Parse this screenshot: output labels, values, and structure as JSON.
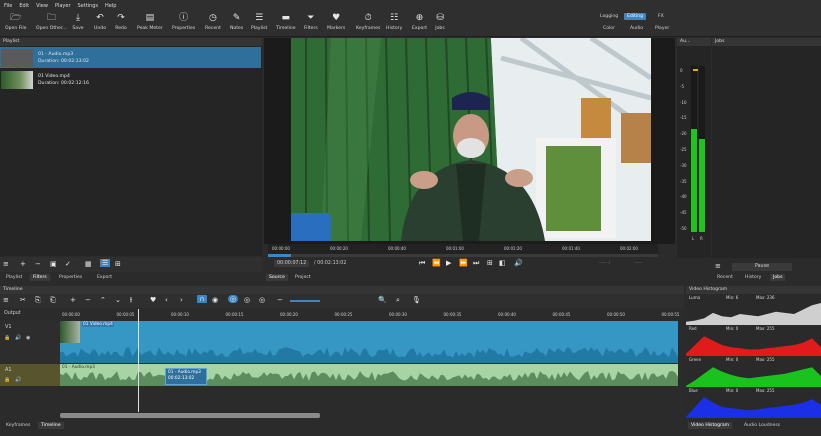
{
  "menu": [
    "File",
    "Edit",
    "View",
    "Player",
    "Settings",
    "Help"
  ],
  "toolbar": [
    {
      "label": "Open File",
      "icon": "folder-icon",
      "glyph": "🗁"
    },
    {
      "label": "Open Other...",
      "icon": "open-other-icon",
      "glyph": "🗀"
    },
    {
      "label": "Save",
      "icon": "save-icon",
      "glyph": "⤓"
    },
    {
      "label": "Undo",
      "icon": "undo-icon",
      "glyph": "↶"
    },
    {
      "label": "Redo",
      "icon": "redo-icon",
      "glyph": "↷"
    },
    {
      "label": "Peak Meter",
      "icon": "peak-meter-icon",
      "glyph": "▤"
    },
    {
      "label": "Properties",
      "icon": "properties-icon",
      "glyph": "ⓘ"
    },
    {
      "label": "Recent",
      "icon": "recent-icon",
      "glyph": "◷"
    },
    {
      "label": "Notes",
      "icon": "notes-icon",
      "glyph": "✎"
    },
    {
      "label": "Playlist",
      "icon": "playlist-icon",
      "glyph": "☰"
    },
    {
      "label": "Timeline",
      "icon": "timeline-icon",
      "glyph": "▬"
    },
    {
      "label": "Filters",
      "icon": "filters-icon",
      "glyph": "⏷"
    },
    {
      "label": "Markers",
      "icon": "markers-icon",
      "glyph": "♥"
    },
    {
      "label": "Keyframes",
      "icon": "keyframes-icon",
      "glyph": "⏱"
    },
    {
      "label": "History",
      "icon": "history-icon",
      "glyph": "☷"
    },
    {
      "label": "Export",
      "icon": "export-icon",
      "glyph": "⊕"
    },
    {
      "label": "Jobs",
      "icon": "jobs-icon",
      "glyph": "⛁"
    }
  ],
  "workspaces": {
    "row1": [
      "Logging",
      "Editing",
      "FX"
    ],
    "row2": [
      "Color",
      "Audio",
      "Player"
    ],
    "selected": "Editing"
  },
  "playlist": {
    "title": "Playlist",
    "items": [
      {
        "name": "01 - Audio.mp3",
        "duration": "Duration: 00:02:13:02",
        "selected": true
      },
      {
        "name": "01 Video.mp4",
        "duration": "Duration: 00:02:12:16",
        "selected": false
      }
    ],
    "tabs": [
      "Playlist",
      "Filters",
      "Properties",
      "Export"
    ]
  },
  "player": {
    "ruler": [
      "00:00:00",
      "00:00:20",
      "00:00:40",
      "00:01:00",
      "00:01:20",
      "00:01:40",
      "00:02:00"
    ],
    "position": "00:00:07:12",
    "duration": "/ 00:02:13:02",
    "tabs": [
      "Source",
      "Project"
    ],
    "progress": 0.06
  },
  "audio": {
    "title": "Au...",
    "labels": [
      "L",
      "R"
    ],
    "scale": [
      "0",
      "-5",
      "-10",
      "-15",
      "-20",
      "-25",
      "-30",
      "-35",
      "-40",
      "-45",
      "-50"
    ],
    "levels": [
      0.62,
      0.56
    ]
  },
  "jobs": {
    "title": "Jobs",
    "pause": "Pause",
    "tabs": [
      "Recent",
      "History",
      "Jobs"
    ]
  },
  "timeline": {
    "title": "Timeline",
    "output_label": "Output",
    "ruler": [
      "00:00:00",
      "00:00:05",
      "00:00:10",
      "00:00:15",
      "00:00:20",
      "00:00:25",
      "00:00:30",
      "00:00:35",
      "00:00:40",
      "00:00:45",
      "00:00:50",
      "00:00:55"
    ],
    "tracks": [
      {
        "name": "V1",
        "clip": "01 Video.mp4"
      },
      {
        "name": "A1",
        "clip": "01 - Audio.mp3",
        "tooltip_name": "01 - Audio.mp3",
        "tooltip_time": "00:02:13:02"
      }
    ],
    "playhead": 0.127,
    "bottom_tabs": [
      "Keyframes",
      "Timeline"
    ]
  },
  "histogram": {
    "title": "Video Histogram",
    "channels": [
      {
        "name": "Luma",
        "min": "Min: 6",
        "max": "Max: 236",
        "color": "#cfcfcf"
      },
      {
        "name": "Red",
        "min": "Min: 0",
        "max": "Max: 255",
        "color": "#e01b1b"
      },
      {
        "name": "Green",
        "min": "Min: 0",
        "max": "Max: 255",
        "color": "#19c21c"
      },
      {
        "name": "Blue",
        "min": "Min: 0",
        "max": "Max: 255",
        "color": "#1b2fe6"
      }
    ],
    "tabs": [
      "Video Histogram",
      "Audio Loudness"
    ]
  }
}
